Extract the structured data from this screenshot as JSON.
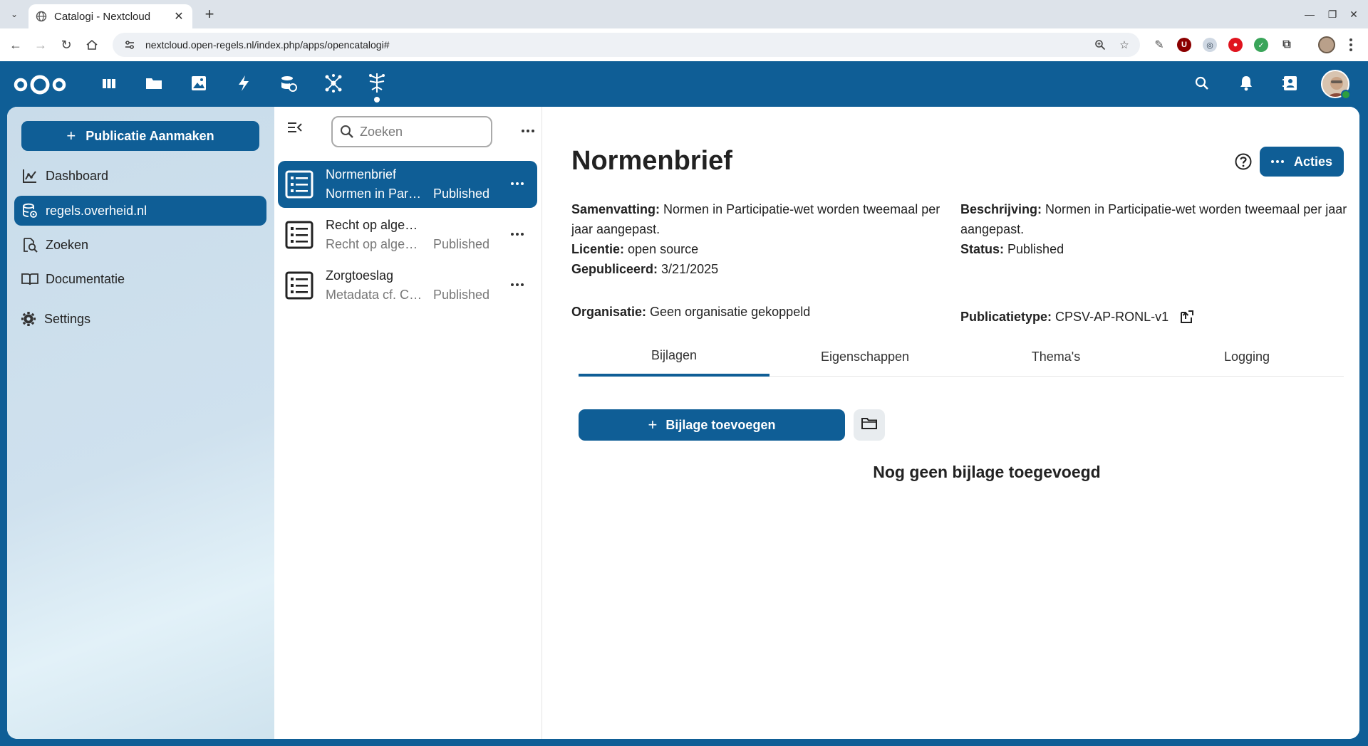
{
  "browser": {
    "tab_title": "Catalogi - Nextcloud",
    "url": "nextcloud.open-regels.nl/index.php/apps/opencatalogi#"
  },
  "nav": {
    "create_label": "Publicatie Aanmaken",
    "items": [
      {
        "label": "Dashboard",
        "icon": "chart-icon"
      },
      {
        "label": "regels.overheid.nl",
        "icon": "database-icon"
      },
      {
        "label": "Zoeken",
        "icon": "search-doc-icon"
      },
      {
        "label": "Documentatie",
        "icon": "book-icon"
      },
      {
        "label": "Settings",
        "icon": "gear-icon"
      }
    ]
  },
  "list": {
    "search_placeholder": "Zoeken",
    "items": [
      {
        "title": "Normenbrief",
        "subtitle": "Normen in Participatie-wet worden tweemaal per jaar aangepast.",
        "status": "Published"
      },
      {
        "title": "Recht op algemene bijstand",
        "subtitle": "Recht op algemene bijstand",
        "status": "Published"
      },
      {
        "title": "Zorgtoeslag",
        "subtitle": "Metadata cf. CPSV-AP",
        "status": "Published"
      }
    ]
  },
  "detail": {
    "title": "Normenbrief",
    "actions_label": "Acties",
    "samenvatting_label": "Samenvatting:",
    "samenvatting": "Normen in Participatie-wet worden tweemaal per jaar aangepast.",
    "beschrijving_label": "Beschrijving:",
    "beschrijving": "Normen in Participatie-wet worden tweemaal per jaar aangepast.",
    "licentie_label": "Licentie:",
    "licentie": "open source",
    "status_label": "Status:",
    "status": "Published",
    "gepubliceerd_label": "Gepubliceerd:",
    "gepubliceerd": "3/21/2025",
    "organisatie_label": "Organisatie:",
    "organisatie": "Geen organisatie gekoppeld",
    "publicatietype_label": "Publicatietype:",
    "publicatietype": "CPSV-AP-RONL-v1",
    "tabs": [
      "Bijlagen",
      "Eigenschappen",
      "Thema's",
      "Logging"
    ],
    "add_attachment_label": "Bijlage toevoegen",
    "empty_message": "Nog geen bijlage toegevoegd"
  },
  "colors": {
    "primary": "#0f5e96",
    "text": "#222222"
  }
}
